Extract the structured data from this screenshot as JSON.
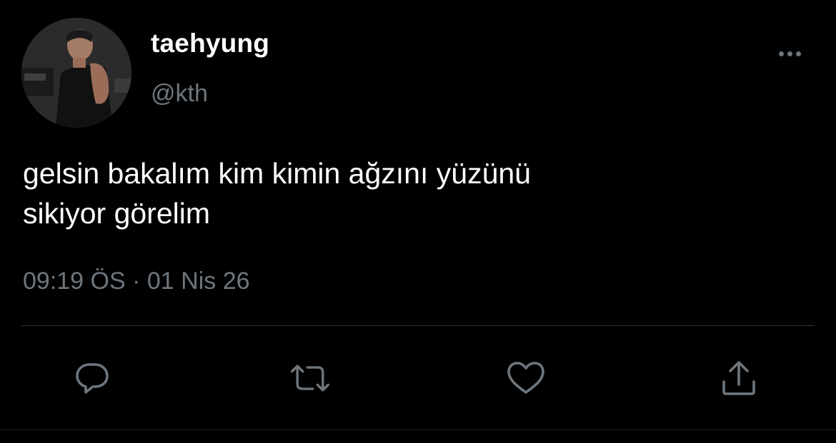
{
  "tweet": {
    "display_name": "taehyung",
    "handle": "@kth",
    "text_line1": "gelsin bakalım kim kimin ağzını yüzünü",
    "text_line2": "sikiyor görelim",
    "time": "09:19 ÖS",
    "separator": "·",
    "date": "01 Nis 26"
  },
  "icons": {
    "more": "more-icon",
    "reply": "reply-icon",
    "retweet": "retweet-icon",
    "like": "heart-icon",
    "share": "share-icon"
  },
  "colors": {
    "background": "#000000",
    "text": "#ffffff",
    "muted": "#6e767d",
    "divider": "#2f3336"
  }
}
